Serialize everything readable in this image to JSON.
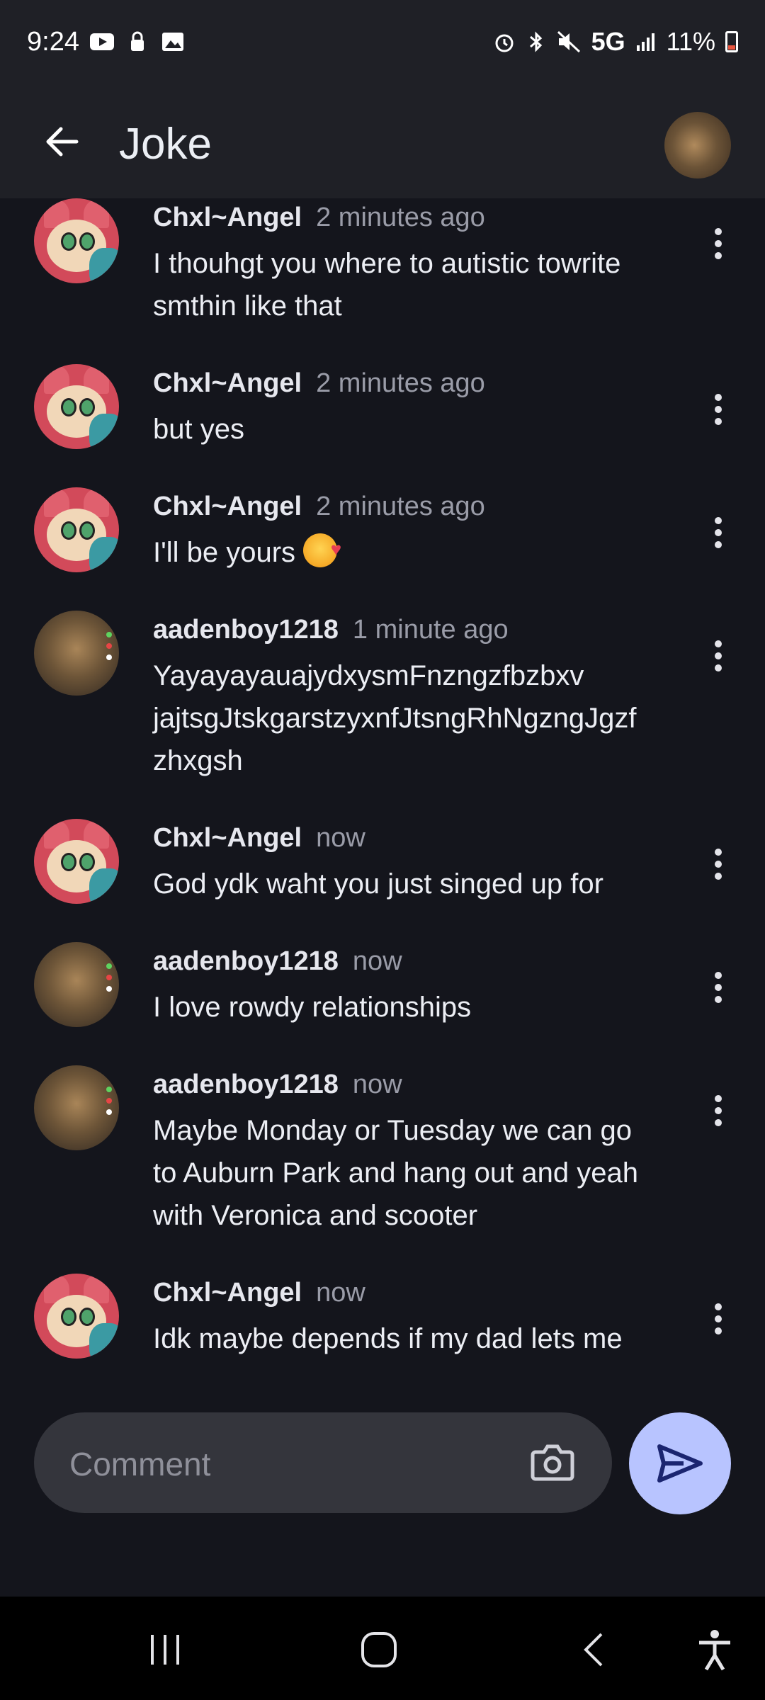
{
  "status_bar": {
    "time": "9:24",
    "network": "5G",
    "battery": "11%"
  },
  "appbar": {
    "title": "Joke"
  },
  "messages": [
    {
      "author": "Chxl~Angel",
      "time": "2 minutes ago",
      "lines": [
        "I thouhgt you where to autistic towrite",
        "smthin like that"
      ],
      "avatar": "angel"
    },
    {
      "author": "Chxl~Angel",
      "time": "2 minutes ago",
      "lines": [
        "but yes"
      ],
      "avatar": "angel"
    },
    {
      "author": "Chxl~Angel",
      "time": "2 minutes ago",
      "lines": [
        "I'll be yours"
      ],
      "avatar": "angel",
      "emoji": "smiling-face-with-hearts"
    },
    {
      "author": "aadenboy1218",
      "time": "1 minute ago",
      "lines": [
        "YayayayauajydxysmFnzngzfbzbxv",
        "jajtsgJtskgarstzyxnfJtsngRhNgzngJgzf",
        "zhxgsh"
      ],
      "avatar": "aaden"
    },
    {
      "author": "Chxl~Angel",
      "time": "now",
      "lines": [
        "God ydk waht you just singed up for"
      ],
      "avatar": "angel"
    },
    {
      "author": "aadenboy1218",
      "time": "now",
      "lines": [
        "I love rowdy relationships"
      ],
      "avatar": "aaden"
    },
    {
      "author": "aadenboy1218",
      "time": "now",
      "lines": [
        "Maybe Monday or Tuesday we can go",
        "to Auburn Park and hang out and yeah",
        "with Veronica and scooter"
      ],
      "avatar": "aaden"
    },
    {
      "author": "Chxl~Angel",
      "time": "now",
      "lines": [
        "Idk maybe depends if my dad lets me"
      ],
      "avatar": "angel"
    }
  ],
  "composer": {
    "placeholder": "Comment"
  },
  "colors": {
    "background": "#14151c",
    "bar": "#1f2026",
    "send_button": "#b8c4ff",
    "input": "#34353c"
  }
}
